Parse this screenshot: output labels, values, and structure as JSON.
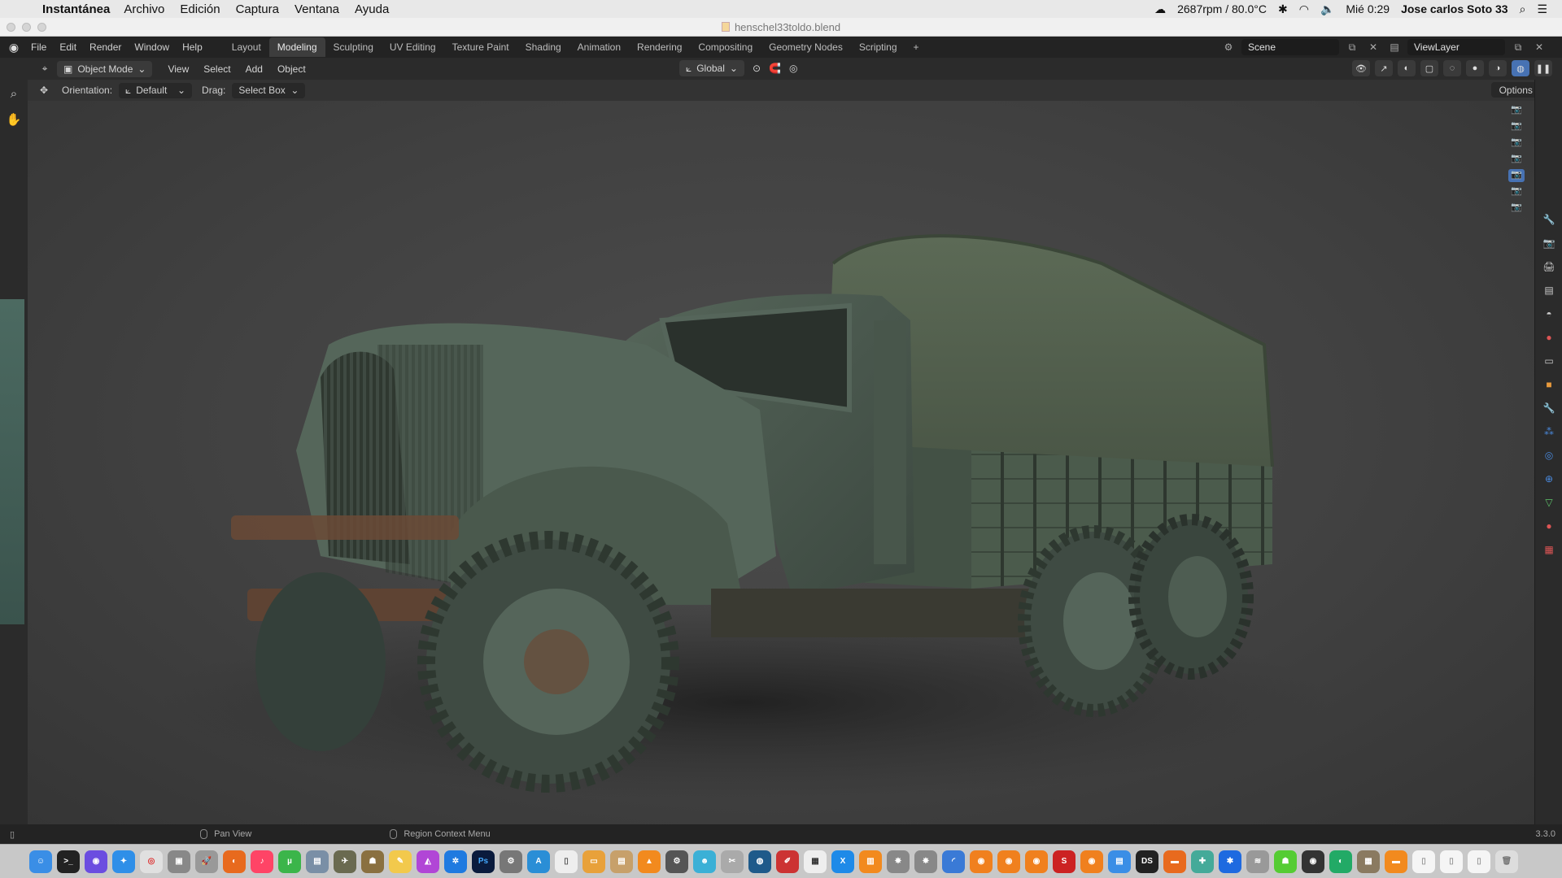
{
  "mac_menubar": {
    "app_name": "Instantánea",
    "menus": [
      "Archivo",
      "Edición",
      "Captura",
      "Ventana",
      "Ayuda"
    ],
    "status": "2687rpm / 80.0°C",
    "clock": "Mié 0:29",
    "user": "Jose carlos Soto 33"
  },
  "window": {
    "title": "henschel33toldo.blend"
  },
  "topbar": {
    "menus": [
      "File",
      "Edit",
      "Render",
      "Window",
      "Help"
    ],
    "workspaces": [
      "Layout",
      "Modeling",
      "Sculpting",
      "UV Editing",
      "Texture Paint",
      "Shading",
      "Animation",
      "Rendering",
      "Compositing",
      "Geometry Nodes",
      "Scripting"
    ],
    "active_workspace": "Modeling",
    "add_label": "+",
    "scene": "Scene",
    "view_layer": "ViewLayer"
  },
  "header": {
    "mode": "Object Mode",
    "menus": [
      "View",
      "Select",
      "Add",
      "Object"
    ],
    "transform_orientation": "Global"
  },
  "toolsettings": {
    "orientation_label": "Orientation:",
    "orientation_value": "Default",
    "drag_label": "Drag:",
    "drag_value": "Select Box",
    "options_label": "Options"
  },
  "status_bar": {
    "hint_1": "Pan View",
    "hint_2": "Region Context Menu",
    "version": "3.3.0"
  },
  "colors": {
    "accent": "#4772b3",
    "truck_green": "#4b5b4c",
    "rust": "#6b4a36"
  },
  "dock": {
    "apps": [
      "finder-icon",
      "terminal-icon",
      "siri-icon",
      "safari-icon",
      "chrome-icon",
      "preview-icon",
      "launchpad-icon",
      "firefox-icon",
      "music-icon",
      "utorrent-icon",
      "photos-icon",
      "game-icon",
      "game2-icon",
      "notes-icon",
      "affinity-icon",
      "settings-icon"
    ]
  }
}
